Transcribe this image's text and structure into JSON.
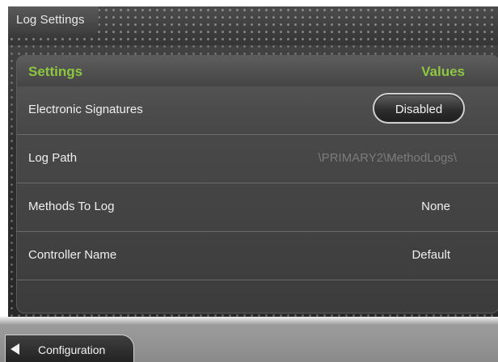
{
  "window": {
    "title": "Log Settings"
  },
  "table": {
    "headers": {
      "settings": "Settings",
      "values": "Values"
    },
    "rows": [
      {
        "label": "Electronic Signatures",
        "value": "Disabled"
      },
      {
        "label": "Log Path",
        "value": "\\PRIMARY2\\MethodLogs\\"
      },
      {
        "label": "Methods To Log",
        "value": "None"
      },
      {
        "label": "Controller Name",
        "value": "Default"
      }
    ]
  },
  "footer": {
    "back_label": "Configuration",
    "back_icon": "left-arrow-icon"
  },
  "colors": {
    "header_accent": "#8dc641"
  }
}
